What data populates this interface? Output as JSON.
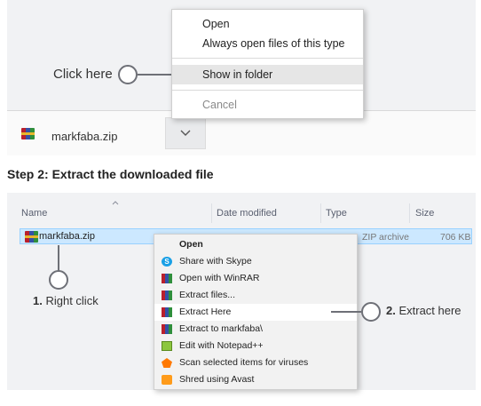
{
  "step1": {
    "callout": "Click here",
    "menu": {
      "items": [
        {
          "label": "Open"
        },
        {
          "label": "Always open files of this type"
        },
        {
          "label": "Show in folder"
        },
        {
          "label": "Cancel"
        }
      ]
    },
    "download": {
      "filename": "markfaba.zip"
    }
  },
  "step2": {
    "heading": "Step 2: Extract the downloaded file",
    "columns": {
      "name": "Name",
      "date": "Date modified",
      "type": "Type",
      "size": "Size"
    },
    "file": {
      "name": "markfaba.zip",
      "type": "ZIP archive",
      "size": "706 KB"
    },
    "callout1": {
      "num": "1.",
      "text": " Right click"
    },
    "callout2": {
      "num": "2.",
      "text": " Extract here"
    },
    "menu": {
      "items": [
        {
          "label": "Open"
        },
        {
          "label": "Share with Skype"
        },
        {
          "label": "Open with WinRAR"
        },
        {
          "label": "Extract files..."
        },
        {
          "label": "Extract Here"
        },
        {
          "label": "Extract to markfaba\\"
        },
        {
          "label": "Edit with Notepad++"
        },
        {
          "label": "Scan selected items for viruses"
        },
        {
          "label": "Shred using Avast"
        }
      ]
    }
  },
  "colors": {
    "highlight": "#cce8ff",
    "selected": "#e6e6e6",
    "panel": "#f1f2f4"
  }
}
